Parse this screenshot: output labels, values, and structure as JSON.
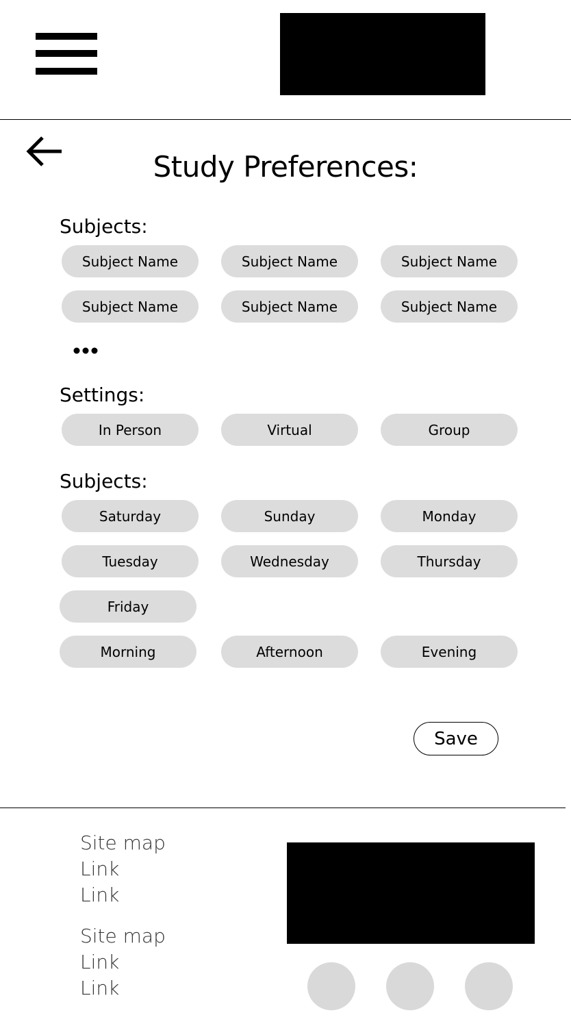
{
  "header": {
    "menu_icon": "hamburger-menu-icon"
  },
  "page": {
    "back_icon": "back-arrow-icon",
    "title": "Study Preferences:"
  },
  "sections": {
    "subjects": {
      "label": "Subjects:",
      "chips": [
        "Subject Name",
        "Subject Name",
        "Subject Name",
        "Subject Name",
        "Subject Name",
        "Subject Name"
      ],
      "more_icon": "ellipsis-icon"
    },
    "settings": {
      "label": "Settings:",
      "chips": [
        "In Person",
        "Virtual",
        "Group"
      ]
    },
    "schedule": {
      "label": "Subjects:",
      "days": [
        "Saturday",
        "Sunday",
        "Monday",
        "Tuesday",
        "Wednesday",
        "Thursday",
        "Friday"
      ],
      "times": [
        "Morning",
        "Afternoon",
        "Evening"
      ]
    }
  },
  "actions": {
    "save_label": "Save"
  },
  "footer": {
    "groups": [
      {
        "title": "Site map",
        "links": [
          "Link",
          "Link"
        ]
      },
      {
        "title": "Site map",
        "links": [
          "Link",
          "Link"
        ]
      }
    ],
    "social_icons": [
      "social-icon-1",
      "social-icon-2",
      "social-icon-3"
    ]
  },
  "colors": {
    "chip_background": "#dcdcdc",
    "social_circle": "#d9d9d9",
    "placeholder_block": "#000000"
  }
}
